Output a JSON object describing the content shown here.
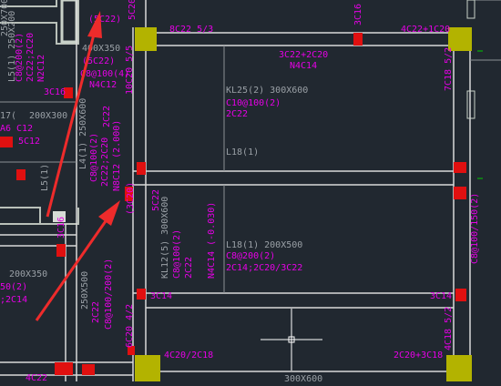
{
  "colors": {
    "background": "#212830",
    "beam_line": "#d9d9d9",
    "wall": "#b9c0b9",
    "column": "#b3b300",
    "annotation": "#e600e6",
    "gray_text": "#9aa0a6",
    "rebar": "#e01010",
    "arrow": "#ee2b2b",
    "grid_green": "#00c800"
  },
  "labels": {
    "left_5c22_top": "(5C22)",
    "left_5c22_mid": "(5C22)",
    "top_5c20": "5C20",
    "top_8c22": "8C22 5/3",
    "top_3c16": "3C16",
    "top_4c22": "4C22+1C20",
    "top_3c22": "3C22+2C20",
    "top_n4c14": "N4C14",
    "right_7c18": "7C18 5/2",
    "col_10c20": "10C20 5/5",
    "kl25_a": "KL25(2) 300X600",
    "kl25_b": "C10@100(2)",
    "kl25_c": "2C22",
    "l18_top": "L18(1)",
    "l18_main_a": "L18(1) 200X500",
    "l18_main_b": "C8@200(2)",
    "l18_main_c": "2C14;2C20/3C22",
    "kl12_a": "KL12(5) 300X600",
    "kl12_b": "C8@100(2)",
    "kl12_c": "2C22",
    "kl12_d": "N4C14 (-0.030)",
    "mid_5c22": "5C22",
    "c3c16_left": "3C16",
    "c3c14_left": "3C14",
    "c3c14_right": "3C14",
    "right_c8": "C8@100/150(2)",
    "bottom_4c20": "4C20/2C18",
    "bottom_2c20": "2C20+3C18",
    "bottom_6c20": "6C20 4/2",
    "bottom_4c18": "4C18 5/2",
    "bottom_4c22": "4C22",
    "bottom_300": "300X600",
    "left_250x500": "250X500",
    "left_2c22": "2C22",
    "left_c8_200": "C8@100/200(2)",
    "left_200x350": "200X350",
    "left_50_2": "50(2)",
    "left_2c14": ";2C14",
    "left_200x300": "200X300",
    "left_17": "17(",
    "left_a6": "A6",
    "left_c12_a": "C12",
    "left_c12_b": "5C12",
    "left_c3c16": "3C16",
    "left_250x700": "250X700",
    "left_l5": "L5(1)",
    "left_col_a": "L5(1) 250X200",
    "left_col_b": "C8@200(2)",
    "left_col_c": "2C22;2C20",
    "left_col_d": "N2C12",
    "left_400": "400X350",
    "left_c8_4": "C8@100(4)",
    "left_n4c12": "N4C12",
    "left_kl_a": "L4(1) 250X600",
    "left_kl_b": "C8@100(2)",
    "left_kl_c": "2C22;2C20",
    "left_kl_d": "N8C12 (2.000)",
    "left_2c22b": "2C22",
    "left_c30": "(3C20)"
  }
}
